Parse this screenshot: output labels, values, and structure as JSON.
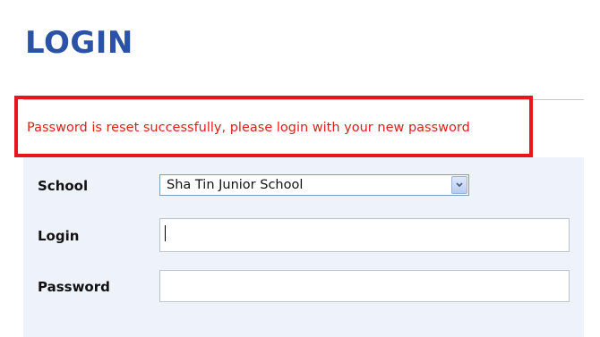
{
  "page": {
    "title": "LOGIN"
  },
  "alert": {
    "message": "Password is reset successfully, please login with your new password"
  },
  "form": {
    "school": {
      "label": "School",
      "selected": "Sha Tin Junior School"
    },
    "login": {
      "label": "Login",
      "value": ""
    },
    "password": {
      "label": "Password",
      "value": ""
    }
  },
  "colors": {
    "title": "#2a52a6",
    "alert_border": "#e8141e",
    "alert_text": "#d9221c",
    "form_background": "#eef3fb"
  },
  "icons": {
    "select_arrow": "chevron-down-icon"
  }
}
